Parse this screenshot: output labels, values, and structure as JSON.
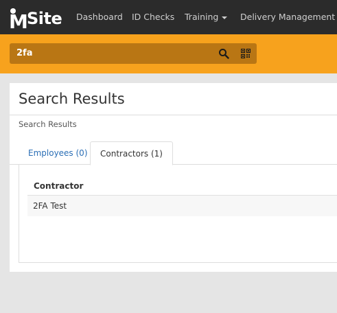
{
  "brand": {
    "logo_text_m": "M",
    "logo_text_site": "Site"
  },
  "nav": {
    "items": [
      {
        "label": "Dashboard"
      },
      {
        "label": "ID Checks"
      },
      {
        "label": "Training"
      },
      {
        "label": "Delivery Management"
      }
    ]
  },
  "search": {
    "value": "2fa"
  },
  "page": {
    "title": "Search Results",
    "breadcrumb": "Search Results"
  },
  "tabs": [
    {
      "label": "Employees (0)",
      "active": false
    },
    {
      "label": "Contractors (1)",
      "active": true
    }
  ],
  "table": {
    "columns": [
      "Contractor"
    ],
    "rows": [
      [
        "2FA Test"
      ]
    ]
  },
  "colors": {
    "nav_bg": "#2b2b2b",
    "accent": "#f7a21d",
    "search_box": "#b97614",
    "link": "#2a6eb5"
  },
  "icons": [
    "search-icon",
    "qr-code-icon",
    "chevron-down-icon"
  ]
}
